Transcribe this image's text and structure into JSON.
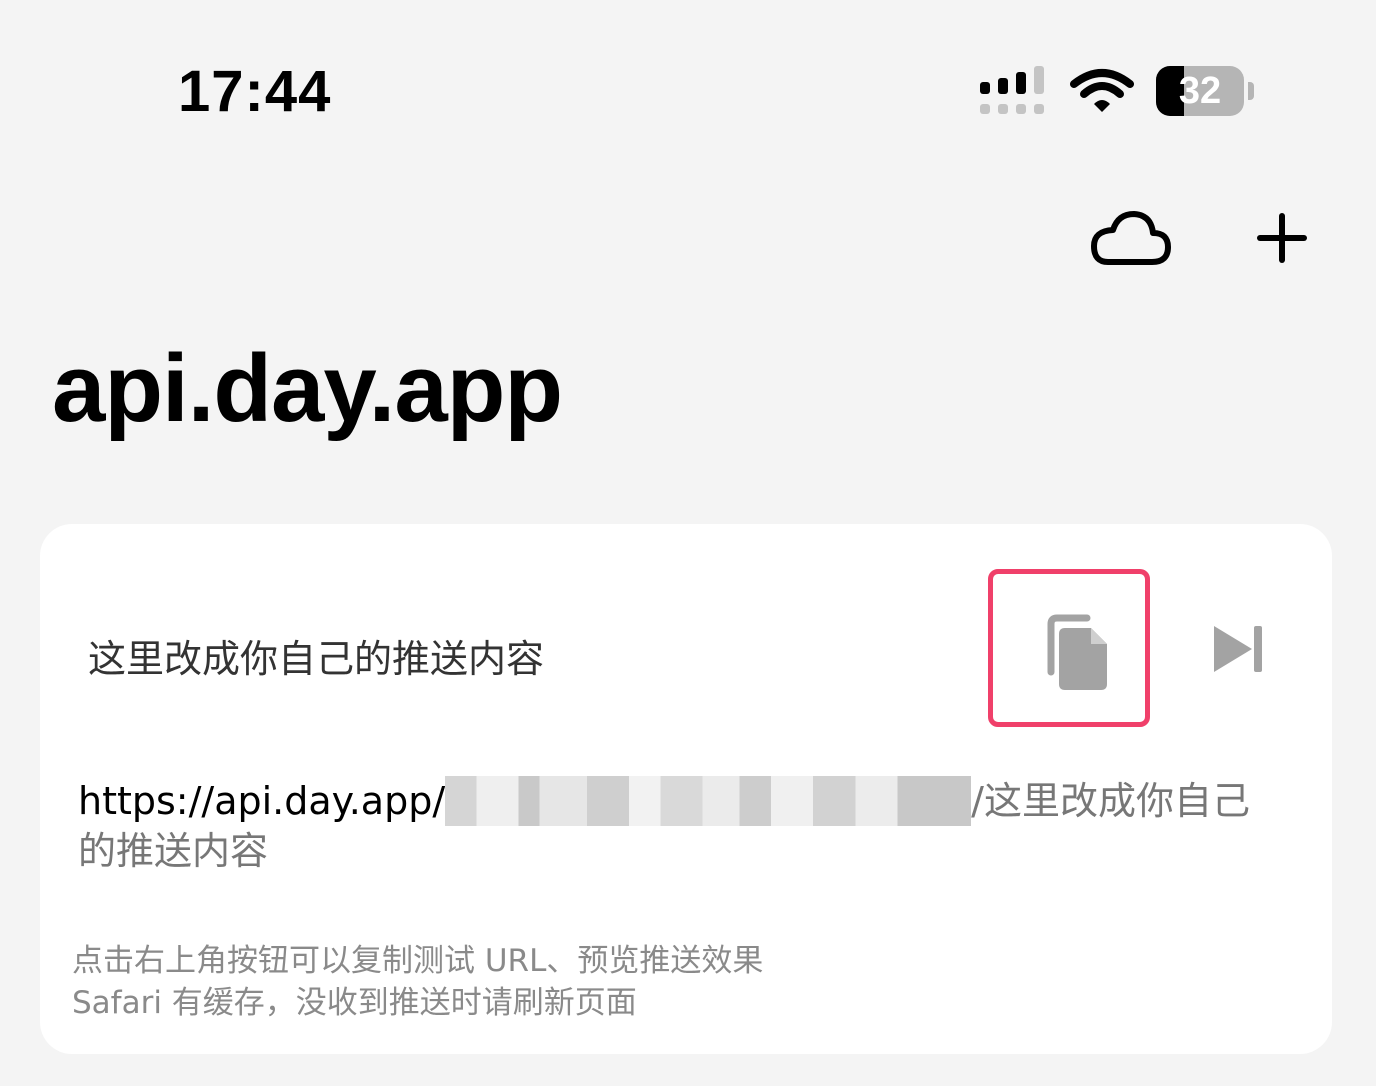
{
  "status_bar": {
    "time": "17:44",
    "battery_percent": "32",
    "battery_level": 0.32
  },
  "nav": {
    "cloud_icon": "cloud-icon",
    "add_icon": "plus-icon"
  },
  "page": {
    "title": "api.day.app"
  },
  "card": {
    "message": "这里改成你自己的推送内容",
    "copy_icon": "copy-icon",
    "skip_icon": "skip-forward-icon",
    "url_prefix": "https://api.day.app/",
    "url_suffix": "/这里改成你自己的推送内容",
    "hint_line1": "点击右上角按钮可以复制测试 URL、预览推送效果",
    "hint_line2": "Safari 有缓存，没收到推送时请刷新页面",
    "highlight_color": "#f0406a"
  }
}
